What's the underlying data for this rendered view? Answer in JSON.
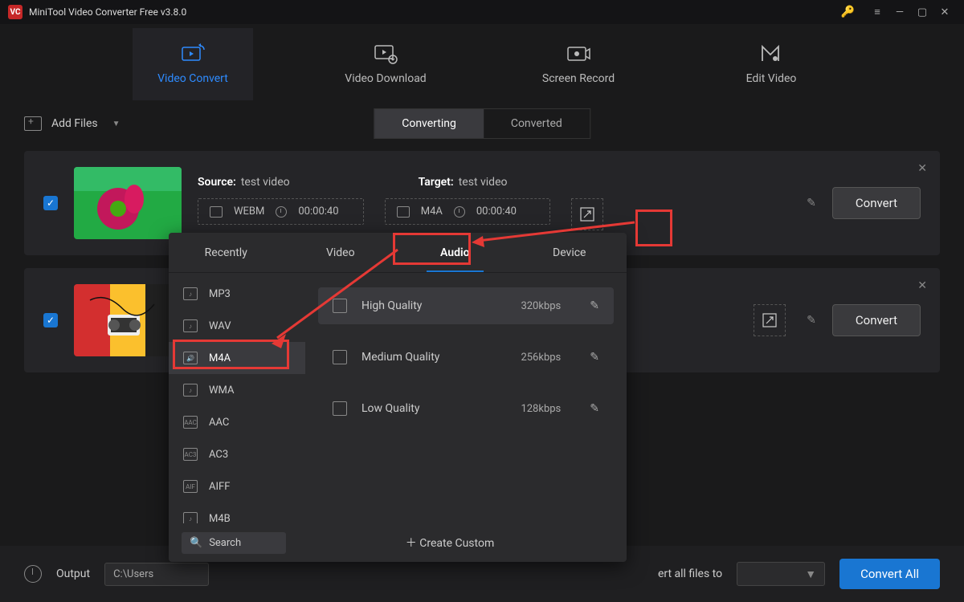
{
  "title": "MiniTool Video Converter Free v3.8.0",
  "main_tabs": [
    {
      "label": "Video Convert",
      "active": true
    },
    {
      "label": "Video Download",
      "active": false
    },
    {
      "label": "Screen Record",
      "active": false
    },
    {
      "label": "Edit Video",
      "active": false
    }
  ],
  "toolbar": {
    "add_files": "Add Files"
  },
  "center_tabs": [
    {
      "label": "Converting",
      "active": true
    },
    {
      "label": "Converted",
      "active": false
    }
  ],
  "rows": [
    {
      "source_label": "Source:",
      "source_name": "test video",
      "source_format": "WEBM",
      "source_duration": "00:00:40",
      "target_label": "Target:",
      "target_name": "test video",
      "target_format": "M4A",
      "target_duration": "00:00:40",
      "convert": "Convert"
    },
    {
      "convert": "Convert"
    }
  ],
  "popup": {
    "tabs": [
      {
        "label": "Recently",
        "active": false
      },
      {
        "label": "Video",
        "active": false
      },
      {
        "label": "Audio",
        "active": true
      },
      {
        "label": "Device",
        "active": false
      }
    ],
    "formats": [
      "MP3",
      "WAV",
      "M4A",
      "WMA",
      "AAC",
      "AC3",
      "AIFF",
      "M4B"
    ],
    "active_format": "M4A",
    "qualities": [
      {
        "label": "High Quality",
        "bitrate": "320kbps",
        "active": true
      },
      {
        "label": "Medium Quality",
        "bitrate": "256kbps",
        "active": false
      },
      {
        "label": "Low Quality",
        "bitrate": "128kbps",
        "active": false
      }
    ],
    "search_placeholder": "Search",
    "create_custom": "Create Custom"
  },
  "bottom": {
    "output_label": "Output",
    "output_path": "C:\\Users",
    "all_files_label": "ert all files to",
    "convert_all": "Convert All"
  }
}
